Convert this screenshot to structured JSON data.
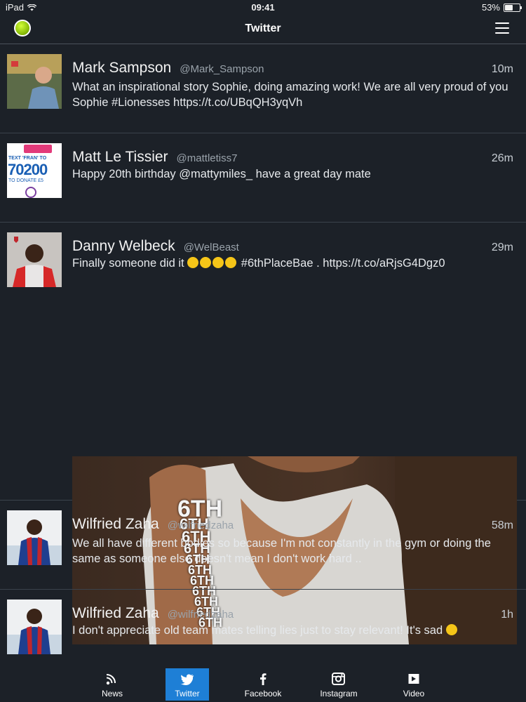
{
  "status_bar": {
    "device": "iPad",
    "time": "09:41",
    "battery": "53%",
    "battery_level": 0.53
  },
  "nav": {
    "title": "Twitter"
  },
  "tweets": [
    {
      "name": "Mark Sampson",
      "handle": "@Mark_Sampson",
      "time": "10m",
      "text": "What an inspirational story Sophie, doing amazing work! We are all very proud of you Sophie #Lionesses https://t.co/UBqQH3yqVh"
    },
    {
      "name": "Matt Le Tissier",
      "handle": "@mattletiss7",
      "time": "26m",
      "text": "Happy 20th birthday @mattymiles_ have a great day mate",
      "avatar_text": {
        "line1": "TEXT 'FRAN' TO",
        "line2": "70200",
        "line3": "TO DONATE £5"
      }
    },
    {
      "name": "Danny Welbeck",
      "handle": "@WelBeast",
      "time": "29m",
      "text_before": "Finally someone did it",
      "text_after": "#6thPlaceBae . https://t.co/aRjsG4Dgz0",
      "media_overlay": [
        "6TH",
        "6TH",
        "6TH",
        "6TH",
        "6TH",
        "6TH",
        "6TH",
        "6TH",
        "6TH",
        "6TH",
        "6TH"
      ]
    },
    {
      "name": "Wilfried Zaha",
      "handle": "@wilfriedzaha",
      "time": "58m",
      "text": "We all have different bodies so because I'm not constantly in the gym or doing the same as someone else doesn't mean I don't work hard .."
    },
    {
      "name": "Wilfried Zaha",
      "handle": "@wilfriedzaha",
      "time": "1h",
      "text": "I don't appreciate old team mates telling lies just to stay relevant! It's sad"
    }
  ],
  "tabs": [
    {
      "label": "News",
      "icon": "rss-icon"
    },
    {
      "label": "Twitter",
      "icon": "twitter-icon",
      "active": true
    },
    {
      "label": "Facebook",
      "icon": "facebook-icon"
    },
    {
      "label": "Instagram",
      "icon": "instagram-icon"
    },
    {
      "label": "Video",
      "icon": "video-icon"
    }
  ],
  "colors": {
    "background": "#1c2128",
    "active_tab": "#1e7fd6",
    "status_dot": "#9fd11b"
  }
}
